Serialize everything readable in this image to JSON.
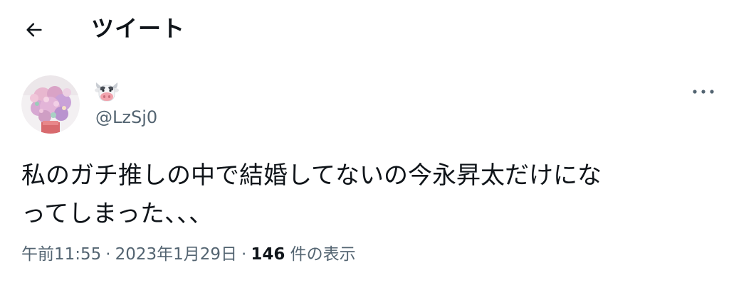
{
  "header": {
    "title": "ツイート"
  },
  "user": {
    "display_name_emoji": "cow-face-emoji",
    "handle": "@LzSj0"
  },
  "tweet": {
    "text": "私のガチ推しの中で結婚してないの今永昇太だけにな\nってしまった、、、"
  },
  "meta": {
    "time": "午前11:55",
    "separator": "·",
    "date": "2023年1月29日",
    "views_count": "146",
    "views_label": " 件の表示"
  },
  "colors": {
    "text": "#0f1419",
    "secondary": "#536471"
  }
}
